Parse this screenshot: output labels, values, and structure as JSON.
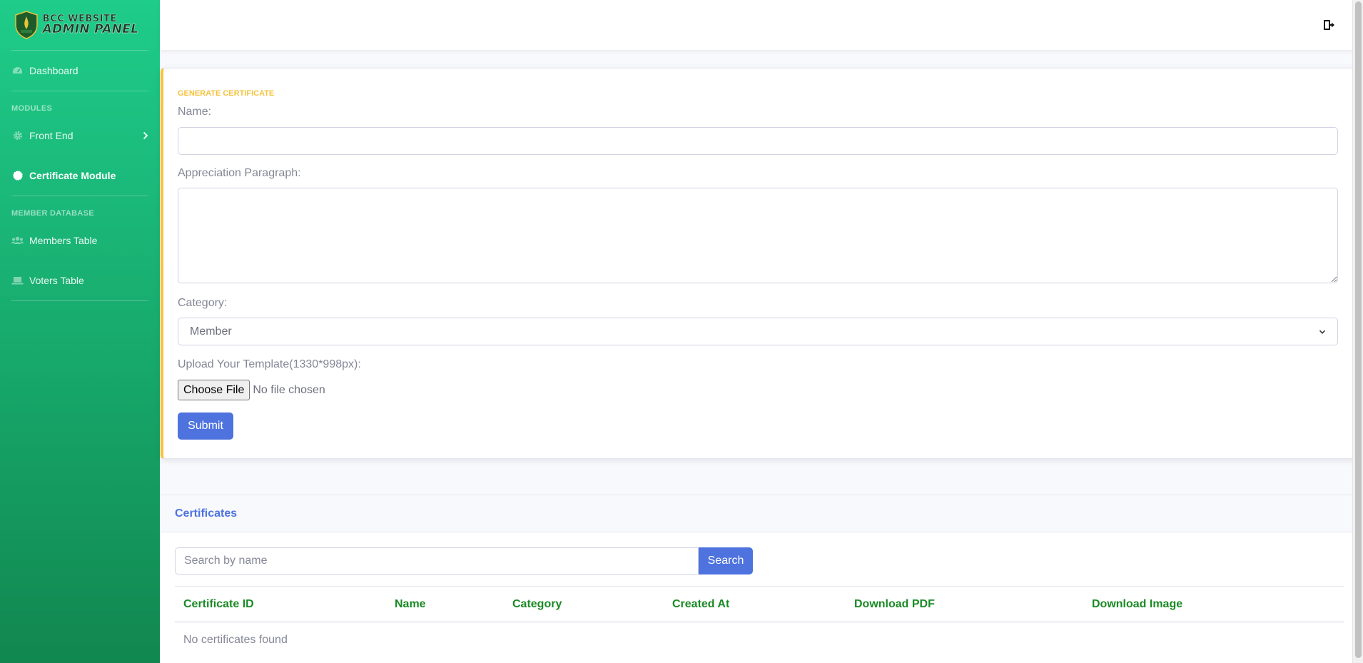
{
  "brand": {
    "line1": "BCC WEBSITE",
    "line2": "ADMIN PANEL"
  },
  "sidebar": {
    "items": [
      {
        "label": "Dashboard",
        "icon": "tachometer-icon"
      },
      {
        "heading": "MODULES"
      },
      {
        "label": "Front End",
        "icon": "gear-icon"
      },
      {
        "label": "Certificate Module",
        "icon": "certificate-icon"
      },
      {
        "heading": "MEMBER DATABASE"
      },
      {
        "label": "Members Table",
        "icon": "users-icon"
      },
      {
        "label": "Voters Table",
        "icon": "laptop-icon"
      }
    ]
  },
  "topbar": {
    "logout_icon": "sign-out-icon"
  },
  "form": {
    "title": "GENERATE CERTIFICATE",
    "name_label": "Name:",
    "name_value": "",
    "paragraph_label": "Appreciation Paragraph:",
    "paragraph_value": "",
    "category_label": "Category:",
    "category_value": "Member",
    "upload_label": "Upload Your Template(1330*998px):",
    "file_button": "Choose File",
    "file_status": "No file chosen",
    "submit_label": "Submit"
  },
  "certificates": {
    "title": "Certificates",
    "search_placeholder": "Search by name",
    "search_button": "Search",
    "columns": [
      "Certificate ID",
      "Name",
      "Category",
      "Created At",
      "Download PDF",
      "Download Image"
    ],
    "empty_message": "No certificates found"
  },
  "colors": {
    "sidebar_top": "#1fcc8a",
    "sidebar_bottom": "#11874f",
    "primary": "#4e73df",
    "warning": "#f6c23e",
    "table_header": "#1a8a25"
  }
}
